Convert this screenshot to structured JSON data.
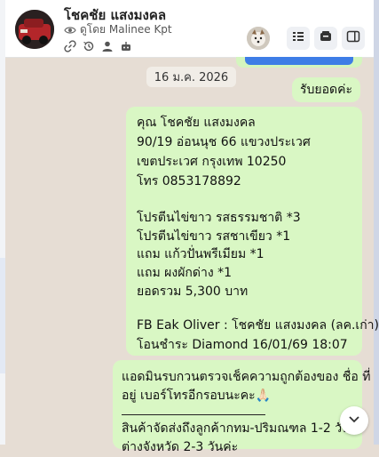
{
  "header": {
    "contact_name": "โชคชัย แสงมงคล",
    "viewed_by": "ดูโดย Malinee Kpt"
  },
  "messages": {
    "date_chip": "16 ม.ค. 2026",
    "reply1": "รับยอดค่ะ",
    "order_lines": [
      "คุณ โชคชัย แสงมงคล",
      "90/19 อ่อนนุช 66 แขวงประเวศ",
      "เขตประเวศ  กรุงเทพ 10250",
      "โทร 0853178892",
      "",
      "โปรตีนไข่ขาว รสธรรมชาติ *3",
      "โปรตีนไข่ขาว รสชาเขียว *1",
      "แถม แก้วปั่นพรีเมียม *1",
      "แถม ผงผักด่าง *1",
      "ยอดรวม 5,300 บาท",
      "",
      "FB Eak Oliver : โชคชัย แสงมงคล (ลค.เก่า)",
      "โอนชำระ Diamond 16/01/69 18:07"
    ],
    "admin_lines": [
      "แอดมินรบกวนตรวจเช็คความถูกต้องของ ชื่อ ที่",
      "อยู่ เบอร์โทรอีกรอบนะคะ🙏🏻",
      "",
      "สินค้าจัดส่งถึงลูกค้ากทม-ปริมณฑล 1-2 วัน",
      "ต่างจังหวัด 2-3 วันค่ะ"
    ]
  },
  "icons": [
    "eye-icon",
    "link-icon",
    "history-icon",
    "person-icon",
    "robot-icon",
    "list-icon",
    "inbox-icon",
    "panel-icon",
    "chevron-down-icon"
  ],
  "colors": {
    "bubble": "#d9f7c4",
    "background": "#e6ddd4",
    "accent_blue": "#3e7de6"
  }
}
